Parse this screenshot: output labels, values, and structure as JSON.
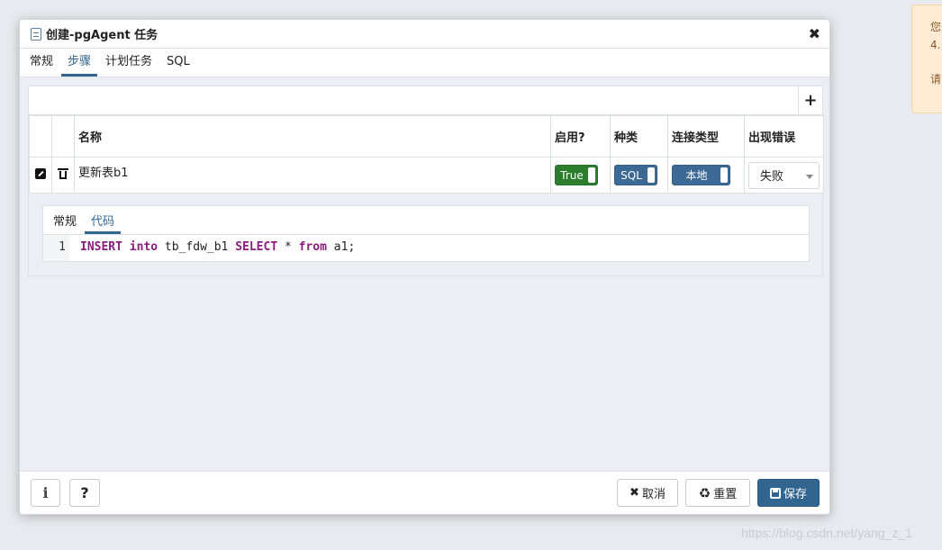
{
  "toast": {
    "line1": "您",
    "line2": "4.",
    "line3": "请"
  },
  "dialog": {
    "title": "创建-pgAgent 任务",
    "tabs": [
      "常规",
      "步骤",
      "计划任务",
      "SQL"
    ],
    "active_tab": "步骤"
  },
  "steps": {
    "add_label": "+",
    "columns": [
      "名称",
      "启用?",
      "种类",
      "连接类型",
      "出现错误"
    ],
    "rows": [
      {
        "name": "更新表b1",
        "enabled": "True",
        "kind": "SQL",
        "connection_type": "本地",
        "on_error": "失败"
      }
    ],
    "detail": {
      "tabs": [
        "常规",
        "代码"
      ],
      "active_tab": "代码",
      "code": {
        "line_number": "1",
        "tokens": [
          {
            "text": "INSERT",
            "type": "keyword"
          },
          {
            "text": " ",
            "type": "plain"
          },
          {
            "text": "into",
            "type": "keyword"
          },
          {
            "text": " tb_fdw_b1 ",
            "type": "plain"
          },
          {
            "text": "SELECT",
            "type": "keyword"
          },
          {
            "text": " * ",
            "type": "plain"
          },
          {
            "text": "from",
            "type": "keyword"
          },
          {
            "text": " a1;",
            "type": "plain"
          }
        ]
      }
    }
  },
  "footer": {
    "info_label": "i",
    "help_label": "?",
    "cancel_label": "取消",
    "reset_label": "重置",
    "save_label": "保存"
  },
  "icons": {
    "title": "clipboard-icon",
    "close": "close-icon",
    "edit": "edit-icon",
    "delete": "trash-icon",
    "cancel": "x-icon",
    "reset": "recycle-icon",
    "save": "floppy-icon"
  },
  "colors": {
    "accent": "#326690",
    "enabled_toggle": "#2c7d2e",
    "kind_toggle": "#3c6a94",
    "sql_keyword": "#8b1b7d"
  },
  "watermark": "https://blog.csdn.net/yang_z_1"
}
